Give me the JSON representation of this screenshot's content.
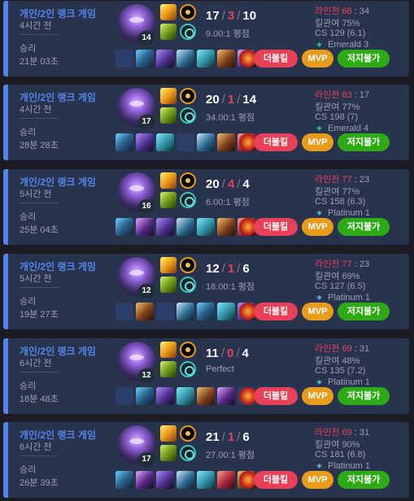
{
  "labels": {
    "lane_label": "라인전",
    "kill_participation_label": "킬관여",
    "cs_label": "CS",
    "perfect": "Perfect",
    "kda_suffix": "평점"
  },
  "colors": {
    "accent": "#5383e8",
    "card_bg": "#28344e",
    "death": "#e84057",
    "double_kill": "#e84057",
    "mvp": "#e89c1b",
    "unstoppable": "#2daa16",
    "emerald": "#2bb47a",
    "platinum": "#4fa6c9"
  },
  "matches": [
    {
      "queue": "개인/2인 랭크 게임",
      "time_ago": "4시간 전",
      "result": "승리",
      "duration": "21분 03초",
      "champion_icon": "champion-portrait-purple",
      "champion_level": "14",
      "spell_icons": [
        "ignite-spell-icon",
        "flash-spell-icon"
      ],
      "rune_icons": [
        "electrocute-rune-icon",
        "sorcery-secondary-rune-icon"
      ],
      "kills": "17",
      "deaths": "3",
      "assists": "10",
      "kda_ratio": "9.00:1 평점",
      "item_icons": [
        "empty-slot",
        "thunderlord-item-icon",
        "void-staff-icon",
        "blackfire-torch-icon",
        "shadowflame-icon",
        "berserker-boots-icon",
        "shadow-mask-item-icon"
      ],
      "ward_icon": "oracle-lens-icon",
      "badges": {
        "double_kill": "더블킬",
        "mvp": "MVP",
        "unstoppable": "저지불가"
      },
      "lane_score": "66",
      "lane_opponent": "34",
      "kill_participation": "75%",
      "cs": "129 (6.1)",
      "tier": "Emerald 3",
      "tier_color": "#2bb47a"
    },
    {
      "queue": "개인/2인 랭크 게임",
      "time_ago": "4시간 전",
      "result": "승리",
      "duration": "28분 28초",
      "champion_icon": "champion-portrait-purple",
      "champion_level": "17",
      "spell_icons": [
        "ignite-spell-icon",
        "flash-spell-icon"
      ],
      "rune_icons": [
        "electrocute-rune-icon",
        "sorcery-secondary-rune-icon"
      ],
      "kills": "20",
      "deaths": "1",
      "assists": "14",
      "kda_ratio": "34.00:1 평점",
      "item_icons": [
        "thunderlord-item-icon",
        "void-staff-icon",
        "shadowflame-icon",
        "empty-slot",
        "blackfire-torch-icon",
        "berserker-boots-icon",
        "rabadon-item-icon"
      ],
      "ward_icon": "oracle-lens-icon",
      "badges": {
        "double_kill": "더블킬",
        "mvp": "MVP",
        "unstoppable": "저지불가"
      },
      "lane_score": "83",
      "lane_opponent": "17",
      "kill_participation": "77%",
      "cs": "198 (7)",
      "tier": "Emerald 4",
      "tier_color": "#2bb47a"
    },
    {
      "queue": "개인/2인 랭크 게임",
      "time_ago": "5시간 전",
      "result": "승리",
      "duration": "25분 04초",
      "champion_icon": "champion-portrait-purple",
      "champion_level": "16",
      "spell_icons": [
        "ignite-spell-icon",
        "flash-spell-icon"
      ],
      "rune_icons": [
        "electrocute-rune-icon",
        "sorcery-secondary-rune-icon"
      ],
      "kills": "20",
      "deaths": "4",
      "assists": "4",
      "kda_ratio": "6.00:1 평점",
      "item_icons": [
        "thunderlord-item-icon",
        "shadow-mask-item-icon",
        "void-staff-icon",
        "blackfire-torch-icon",
        "shadowflame-icon",
        "berserker-boots-icon",
        "rabadon-item-icon"
      ],
      "ward_icon": "oracle-lens-icon",
      "badges": {
        "double_kill": "더블킬",
        "mvp": "MVP",
        "unstoppable": "저지불가"
      },
      "lane_score": "77",
      "lane_opponent": "23",
      "kill_participation": "77%",
      "cs": "158 (6.3)",
      "tier": "Platinum 1",
      "tier_color": "#4fa6c9"
    },
    {
      "queue": "개인/2인 랭크 게임",
      "time_ago": "5시간 전",
      "result": "승리",
      "duration": "19분 27초",
      "champion_icon": "champion-portrait-purple",
      "champion_level": "12",
      "spell_icons": [
        "ignite-spell-icon",
        "flash-spell-icon"
      ],
      "rune_icons": [
        "electrocute-rune-icon",
        "sorcery-secondary-rune-icon"
      ],
      "kills": "12",
      "deaths": "1",
      "assists": "6",
      "kda_ratio": "18.00:1 평점",
      "item_icons": [
        "empty-slot",
        "berserker-boots-icon",
        "empty-slot",
        "blackfire-torch-icon",
        "thunderlord-item-icon",
        "shadowflame-icon",
        "void-staff-icon"
      ],
      "ward_icon": "oracle-lens-icon",
      "badges": {
        "double_kill": "더블킬",
        "mvp": "MVP",
        "unstoppable": "저지불가"
      },
      "lane_score": "77",
      "lane_opponent": "23",
      "kill_participation": "69%",
      "cs": "127 (6.5)",
      "tier": "Platinum 1",
      "tier_color": "#4fa6c9"
    },
    {
      "queue": "개인/2인 랭크 게임",
      "time_ago": "6시간 전",
      "result": "승리",
      "duration": "18분 48초",
      "champion_icon": "champion-portrait-purple",
      "champion_level": "12",
      "spell_icons": [
        "ignite-spell-icon",
        "flash-spell-icon"
      ],
      "rune_icons": [
        "electrocute-rune-icon",
        "sorcery-secondary-rune-icon"
      ],
      "kills": "11",
      "deaths": "0",
      "assists": "4",
      "kda_ratio": "Perfect",
      "item_icons": [
        "empty-slot",
        "thunderlord-item-icon",
        "void-staff-icon",
        "shadowflame-icon",
        "berserker-boots-icon",
        "shadow-mask-item-icon",
        "empty-slot"
      ],
      "ward_icon": "oracle-lens-icon",
      "badges": {
        "double_kill": "더블킬",
        "mvp": "MVP",
        "unstoppable": "저지불가"
      },
      "lane_score": "69",
      "lane_opponent": "31",
      "kill_participation": "48%",
      "cs": "135 (7.2)",
      "tier": "Platinum 1",
      "tier_color": "#4fa6c9"
    },
    {
      "queue": "개인/2인 랭크 게임",
      "time_ago": "6시간 전",
      "result": "승리",
      "duration": "26분 39초",
      "champion_icon": "champion-portrait-purple",
      "champion_level": "17",
      "spell_icons": [
        "ignite-spell-icon",
        "flash-spell-icon"
      ],
      "rune_icons": [
        "electrocute-rune-icon",
        "sorcery-secondary-rune-icon"
      ],
      "kills": "21",
      "deaths": "1",
      "assists": "6",
      "kda_ratio": "27.00:1 평점",
      "item_icons": [
        "thunderlord-item-icon",
        "shadow-mask-item-icon",
        "void-staff-icon",
        "blackfire-torch-icon",
        "shadowflame-icon",
        "rabadon-item-icon",
        "berserker-boots-icon"
      ],
      "ward_icon": "oracle-lens-icon",
      "badges": {
        "double_kill": "더블킬",
        "mvp": "MVP",
        "unstoppable": "저지불가"
      },
      "lane_score": "69",
      "lane_opponent": "31",
      "kill_participation": "90%",
      "cs": "181 (6.8)",
      "tier": "Platinum 1",
      "tier_color": "#4fa6c9"
    }
  ]
}
